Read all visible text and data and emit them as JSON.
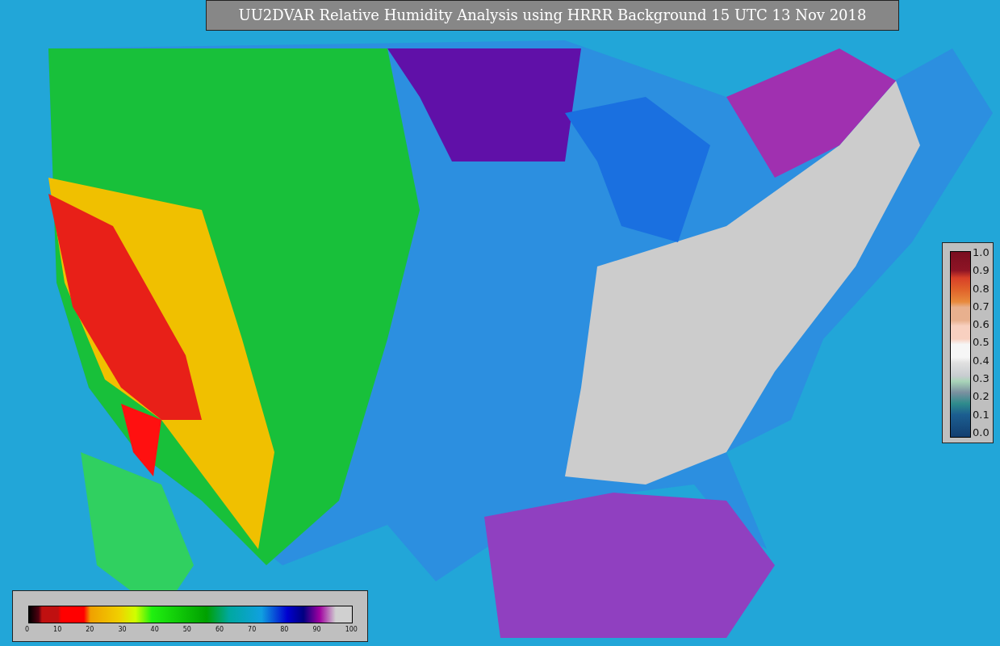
{
  "title": "UU2DVAR Relative Humidity Analysis using HRRR Background 15 UTC 13 Nov 2018",
  "station_colorbar": {
    "ticks": [
      "1.0",
      "0.9",
      "0.8",
      "0.7",
      "0.6",
      "0.5",
      "0.4",
      "0.3",
      "0.2",
      "0.1",
      "0.0"
    ]
  },
  "humidity_colorbar": {
    "ticks": [
      "0",
      "10",
      "20",
      "30",
      "40",
      "50",
      "60",
      "70",
      "80",
      "90",
      "100"
    ]
  }
}
